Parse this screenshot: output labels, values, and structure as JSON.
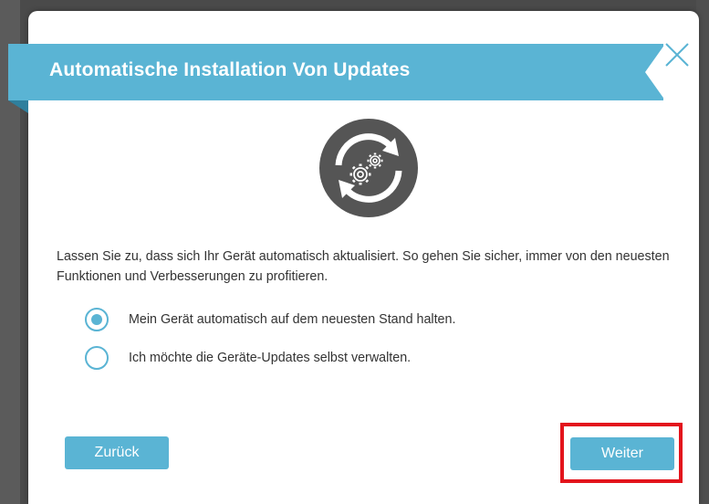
{
  "dialog": {
    "title": "Automatische Installation Von Updates",
    "close_icon": "close-x-icon",
    "hero_icon": "auto-update-gears-icon",
    "description": "Lassen Sie zu, dass sich Ihr Gerät automatisch aktualisiert. So gehen Sie sicher, immer von den neuesten Funktionen und Verbesserungen zu profitieren.",
    "options": [
      {
        "label": "Mein Gerät automatisch auf dem neuesten Stand halten.",
        "selected": true
      },
      {
        "label": "Ich möchte die Geräte-Updates selbst verwalten.",
        "selected": false
      }
    ],
    "back_label": "Zurück",
    "next_label": "Weiter"
  },
  "colors": {
    "accent": "#5ab4d4",
    "accent_dark": "#2f7f9d",
    "highlight": "#e3141c",
    "icon_circle": "#555555"
  }
}
